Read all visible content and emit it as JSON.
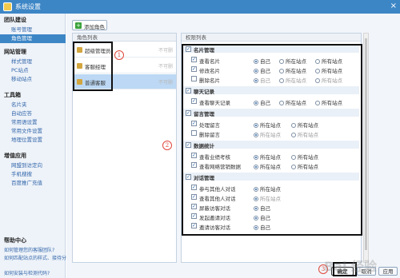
{
  "window": {
    "title": "系统设置",
    "close_label": "×"
  },
  "sidebar": {
    "sections": [
      {
        "title": "团队建设",
        "items": [
          {
            "label": "账号管理"
          },
          {
            "label": "角色管理"
          }
        ]
      },
      {
        "title": "网站管理",
        "items": [
          {
            "label": "样式管理"
          },
          {
            "label": "PC站点"
          },
          {
            "label": "移动站点"
          }
        ]
      },
      {
        "title": "工具箱",
        "items": [
          {
            "label": "名片夹"
          },
          {
            "label": "自动应答"
          },
          {
            "label": "常用语设置"
          },
          {
            "label": "常用文件设置"
          },
          {
            "label": "地理位置设置"
          }
        ]
      },
      {
        "title": "增值应用",
        "items": [
          {
            "label": "网盟到访定向"
          },
          {
            "label": "手机搜搜"
          },
          {
            "label": "百度推广充值"
          }
        ]
      }
    ],
    "help": {
      "title": "帮助中心",
      "links": [
        "如何管理您的客服团队?",
        "如何匹配站点的样式、接待分组?",
        "如何安装与检测代码?"
      ]
    }
  },
  "toolbar": {
    "add_role_label": "添加角色",
    "add_icon": "plus-icon"
  },
  "roles": {
    "header": "角色列表",
    "items": [
      {
        "name": "超级管理员",
        "action": "不可删"
      },
      {
        "name": "客服经理",
        "action": "不可删"
      },
      {
        "name": "普通客服",
        "action": "不可删"
      }
    ]
  },
  "permissions": {
    "header": "权限列表",
    "options": {
      "self": "自己",
      "site": "所在站点",
      "all": "所有站点"
    },
    "groups": [
      {
        "name": "名片管理",
        "items": [
          {
            "label": "查看名片",
            "checked": true,
            "selected": "self"
          },
          {
            "label": "修改名片",
            "checked": true,
            "selected": "self"
          },
          {
            "label": "删除名片",
            "checked": false,
            "selected": "self"
          }
        ]
      },
      {
        "name": "聊天记录",
        "items": [
          {
            "label": "查看聊天记录",
            "checked": true,
            "selected": "self"
          }
        ]
      },
      {
        "name": "留言管理",
        "items": [
          {
            "label": "处理留言",
            "checked": true,
            "selected": "site"
          },
          {
            "label": "删除留言",
            "checked": false,
            "selected": "site"
          }
        ]
      },
      {
        "name": "数据统计",
        "items": [
          {
            "label": "查看业绩考核",
            "checked": true,
            "selected": "site"
          },
          {
            "label": "查看网络营销数据",
            "checked": true,
            "selected": "site"
          }
        ]
      },
      {
        "name": "对话管理",
        "items": [
          {
            "label": "参与其他人对话",
            "checked": true,
            "selected": "site"
          },
          {
            "label": "查看其他人对话",
            "checked": true,
            "selected": "site"
          },
          {
            "label": "屏蔽访客对话",
            "checked": true,
            "selected": "self"
          },
          {
            "label": "发起邀请对话",
            "checked": true,
            "selected": "self"
          },
          {
            "label": "邀请访客对话",
            "checked": true,
            "selected": "self"
          }
        ]
      }
    ]
  },
  "footer": {
    "ok_label": "确定",
    "cancel_label": "取消",
    "apply_label": "应用"
  },
  "annotations": [
    "1",
    "2",
    "3"
  ],
  "watermark": "Bai 经验",
  "colors": {
    "accent": "#3d86c6",
    "selected_row": "#bcd8f4",
    "annotation": "#e0483c"
  }
}
